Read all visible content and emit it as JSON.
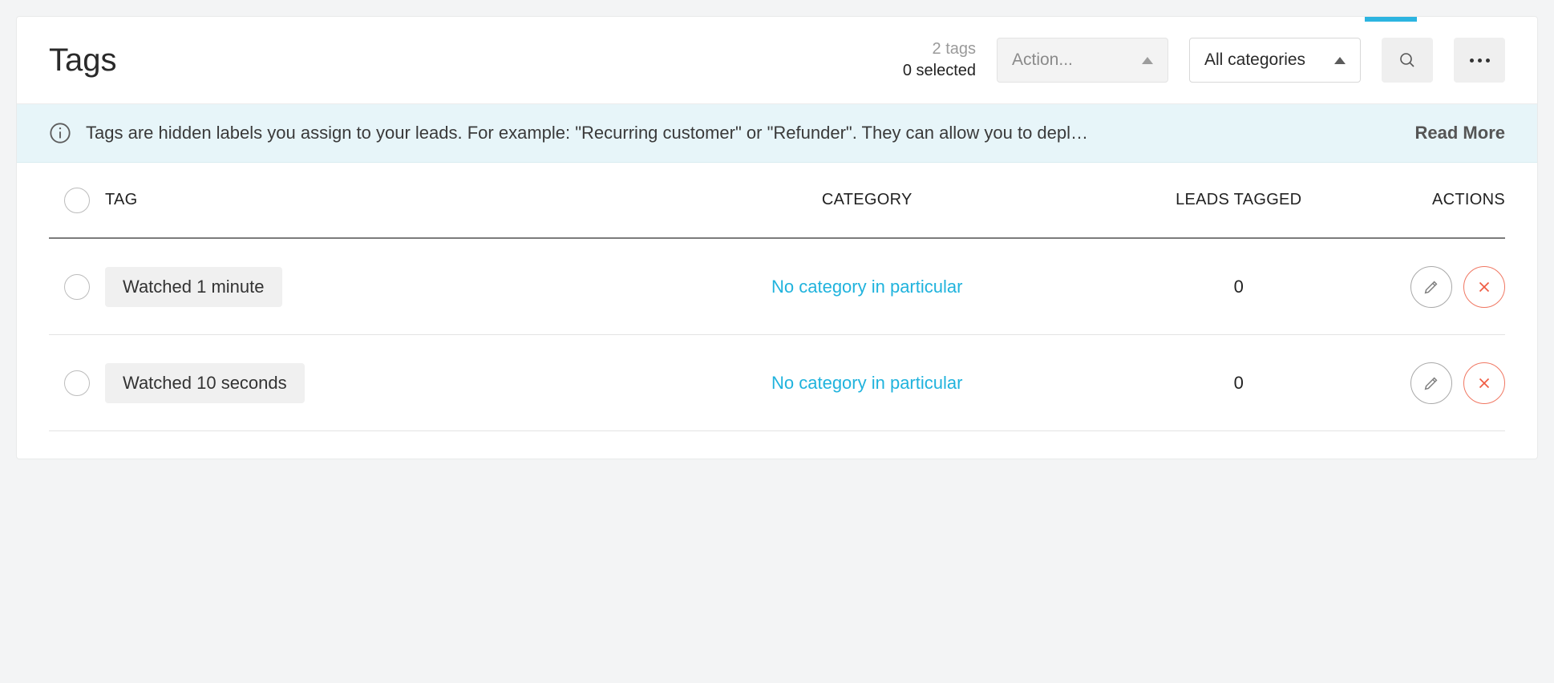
{
  "header": {
    "title": "Tags",
    "counts": {
      "tags": "2 tags",
      "selected": "0 selected"
    },
    "action_select": "Action...",
    "category_select": "All categories"
  },
  "info": {
    "text": "Tags are hidden labels you assign to your leads. For example: \"Recurring customer\" or \"Refunder\". They can allow you to depl…",
    "read_more": "Read More"
  },
  "table": {
    "columns": {
      "tag": "Tag",
      "category": "Category",
      "leads": "Leads Tagged",
      "actions": "Actions"
    },
    "rows": [
      {
        "name": "Watched 1 minute",
        "category": "No category in particular",
        "leads": "0"
      },
      {
        "name": "Watched 10 seconds",
        "category": "No category in particular",
        "leads": "0"
      }
    ]
  }
}
